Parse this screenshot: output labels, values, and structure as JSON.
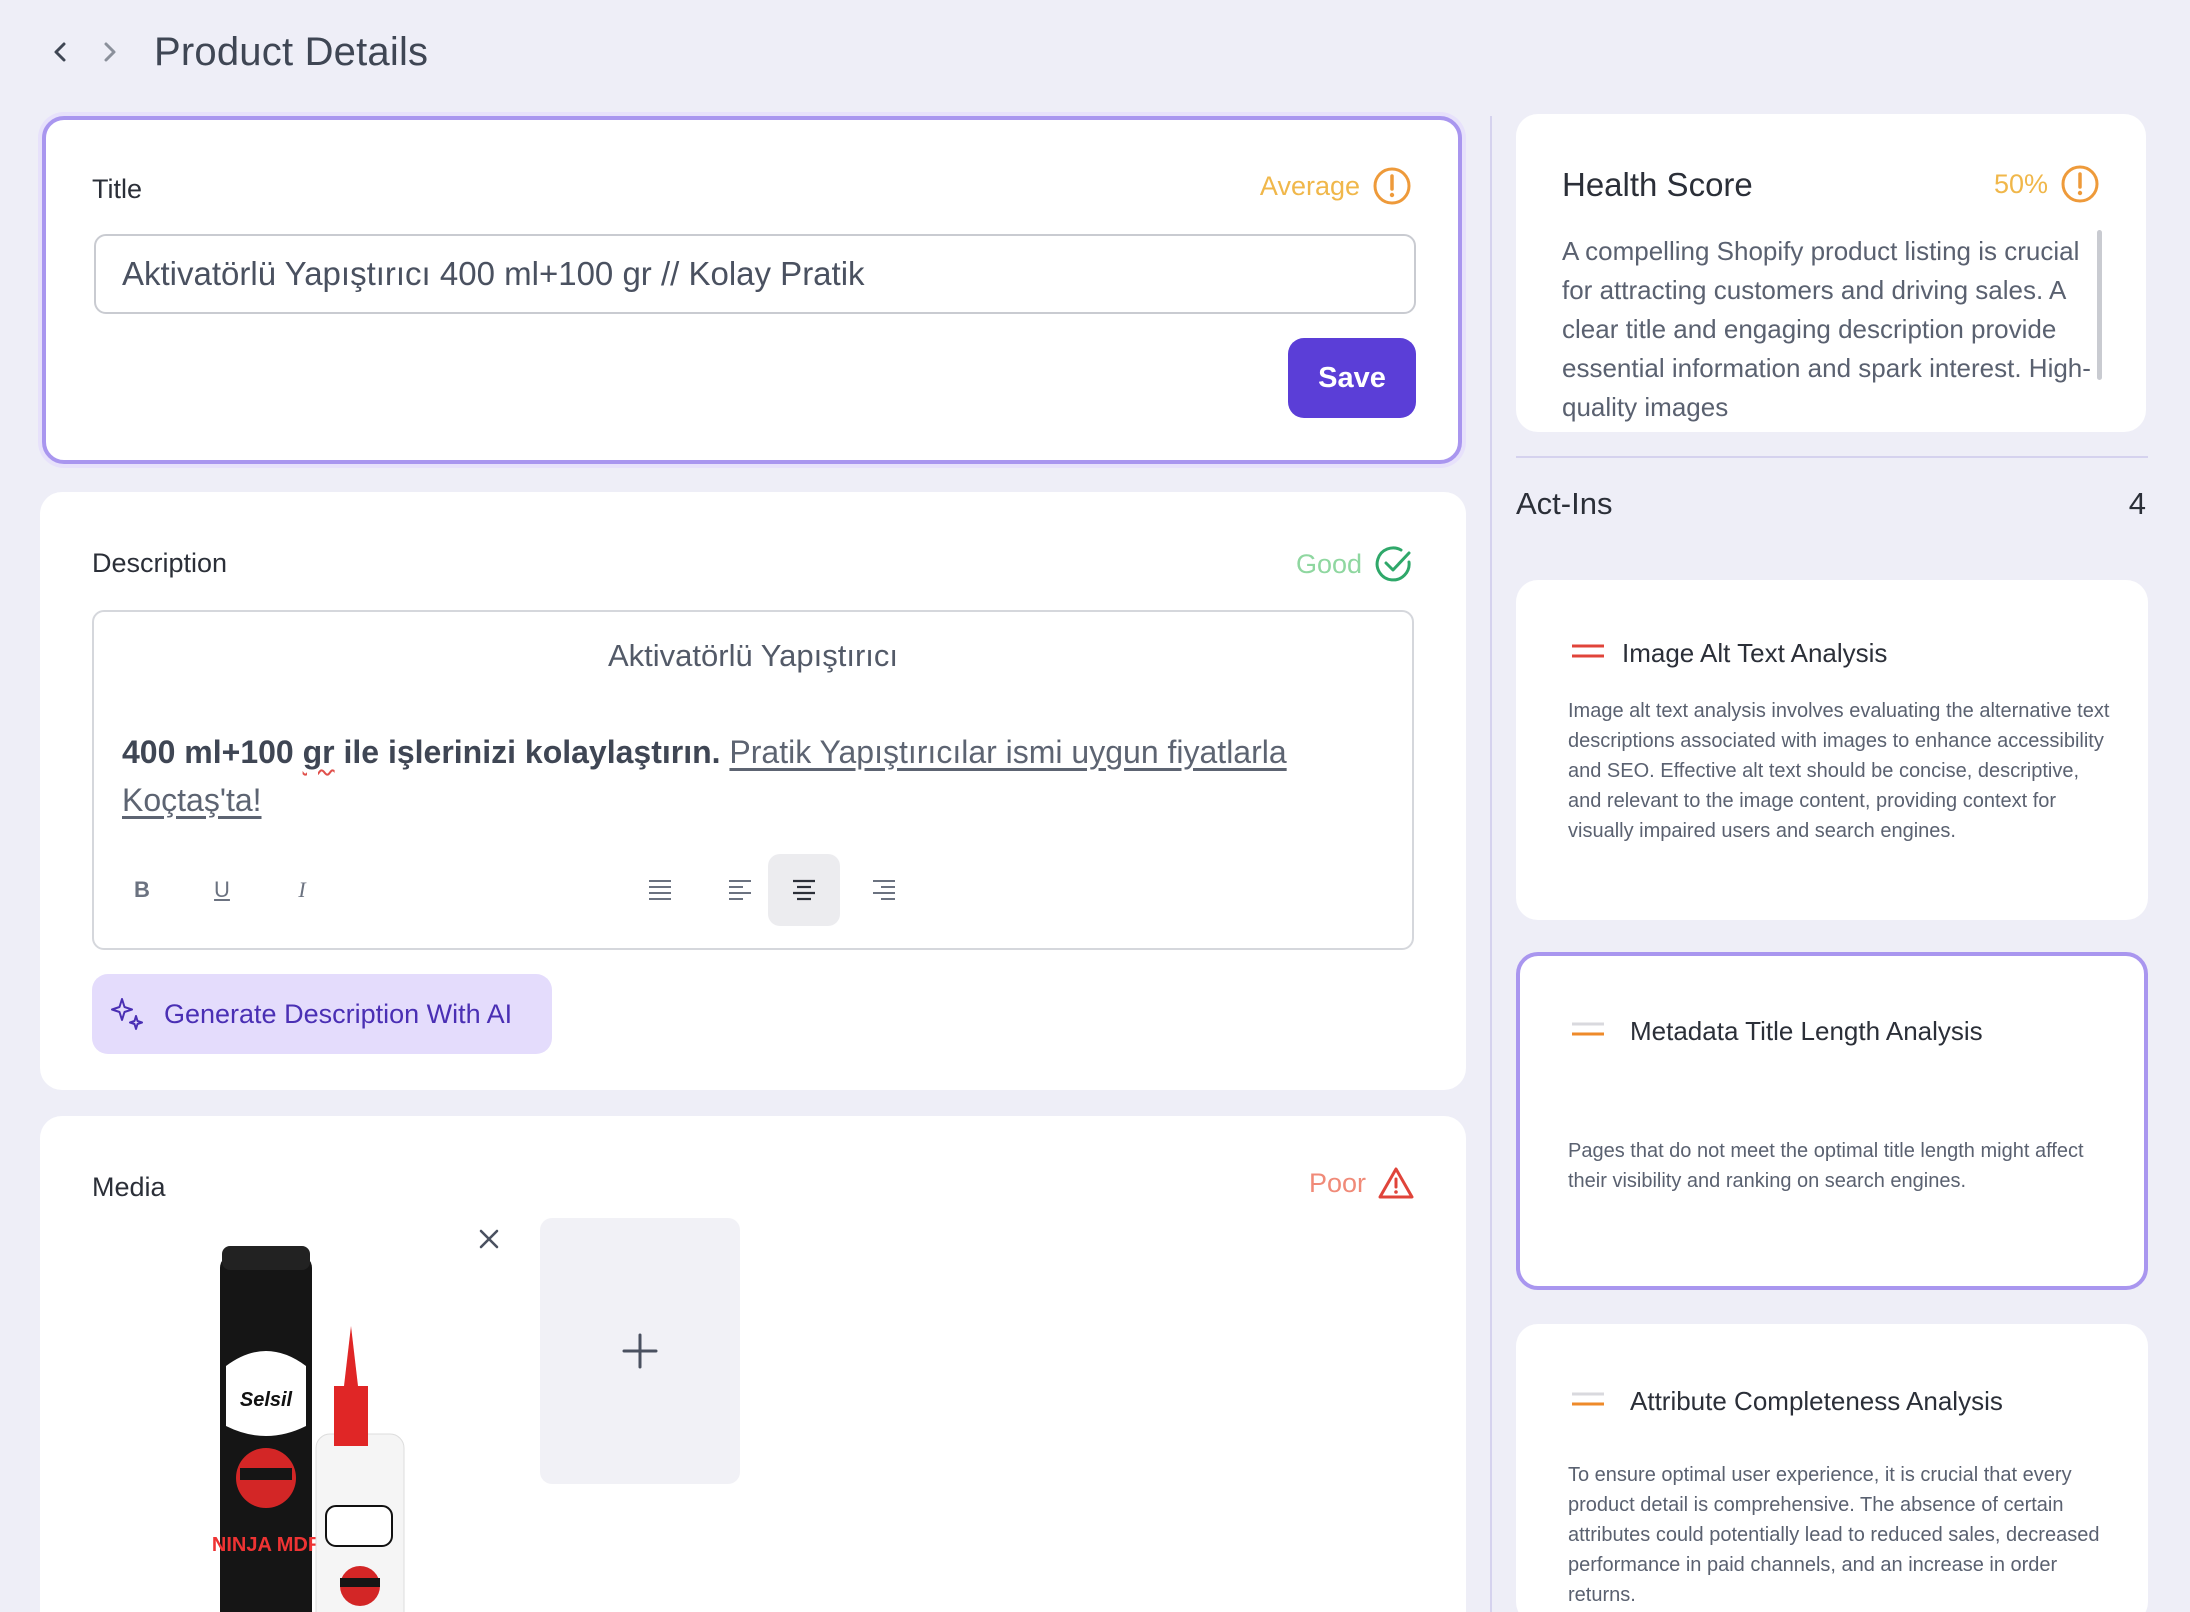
{
  "header": {
    "title": "Product Details"
  },
  "title_section": {
    "label": "Title",
    "status": "Average",
    "value": "Aktivatörlü Yapıştırıcı 400 ml+100 gr // Kolay Pratik",
    "save_label": "Save"
  },
  "description_section": {
    "label": "Description",
    "status": "Good",
    "heading": "Aktivatörlü Yapıştırıcı",
    "bold_part1": "400 ml+100 ",
    "bold_misspelled": "gr",
    "bold_part2": " ile işlerinizi kolaylaştırın.",
    "link_text": "Pratik Yapıştırıcılar ismi uygun fiyatlarla Koçtaş'ta!",
    "toolbar": {
      "bold": "B",
      "underline": "U",
      "italic": "I"
    },
    "generate_label": "Generate Description With AI"
  },
  "media_section": {
    "label": "Media",
    "status": "Poor",
    "product_brand": "Selsil",
    "product_name": "NINJA MDF"
  },
  "health": {
    "title": "Health Score",
    "score": "50%",
    "text": "A compelling Shopify product listing is crucial for attracting customers and driving sales. A clear title and engaging description provide essential information and spark interest. High-quality images"
  },
  "actins": {
    "label": "Act-Ins",
    "count": "4",
    "items": [
      {
        "title": "Image Alt Text Analysis",
        "description": "Image alt text analysis involves evaluating the alternative text descriptions associated with images to enhance accessibility and SEO. Effective alt text should be concise, descriptive, and relevant to the image content, providing context for visually impaired users and search engines.",
        "severity": "high"
      },
      {
        "title": "Metadata Title Length Analysis",
        "description": "Pages that do not meet the optimal title length might affect their visibility and ranking on search engines.",
        "severity": "medium"
      },
      {
        "title": "Attribute Completeness Analysis",
        "description": "To ensure optimal user experience, it is crucial that every product detail is comprehensive. The absence of certain attributes could potentially lead to reduced sales, decreased performance in paid channels, and an increase in order returns.",
        "severity": "medium"
      }
    ]
  },
  "colors": {
    "accent": "#5b3ed7",
    "average": "#f0b74a",
    "good": "#8fd7a0",
    "poor": "#f08a78",
    "selected_border": "#a996ef"
  }
}
